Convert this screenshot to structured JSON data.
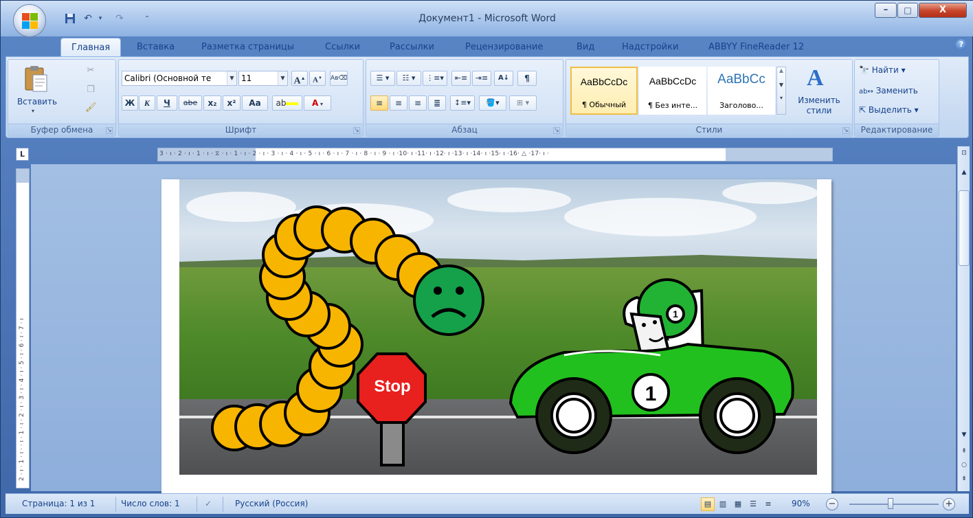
{
  "window": {
    "title": "Документ1 - Microsoft Word",
    "buttons": {
      "minimize": "–",
      "maximize": "□",
      "close": "X"
    }
  },
  "quick_access": {
    "save_icon": "save-icon",
    "undo_icon": "undo-icon",
    "redo_icon": "redo-icon"
  },
  "tabs": [
    {
      "label": "Главная",
      "active": true
    },
    {
      "label": "Вставка"
    },
    {
      "label": "Разметка страницы"
    },
    {
      "label": "Ссылки"
    },
    {
      "label": "Рассылки"
    },
    {
      "label": "Рецензирование"
    },
    {
      "label": "Вид"
    },
    {
      "label": "Надстройки"
    },
    {
      "label": "ABBYY FineReader 12"
    }
  ],
  "ribbon": {
    "clipboard": {
      "label": "Буфер обмена",
      "paste": "Вставить"
    },
    "font": {
      "label": "Шрифт",
      "font_name": "Calibri (Основной те",
      "font_size": "11",
      "bold": "Ж",
      "italic": "К",
      "underline": "Ч",
      "strike": "abe",
      "subscript": "x₂",
      "superscript": "x²",
      "case": "Aa"
    },
    "paragraph": {
      "label": "Абзац",
      "pilcrow": "¶"
    },
    "styles": {
      "label": "Стили",
      "items": [
        {
          "sample": "AaBbCcDc",
          "name": "¶ Обычный"
        },
        {
          "sample": "AaBbCcDc",
          "name": "¶ Без инте..."
        },
        {
          "sample": "AaBbCc",
          "name": "Заголово..."
        }
      ],
      "change_styles": "Изменить стили"
    },
    "editing": {
      "label": "Редактирование",
      "find": "Найти",
      "replace": "Заменить",
      "select": "Выделить"
    }
  },
  "ruler": {
    "horizontal": "3 · ı · 2 · ı · 1 · ı · ⧖ · ı · 1 · ı · 2 · ı · 3 · ı · 4 · ı · 5 · ı · 6 · ı · 7 · ı · 8 · ı · 9 · ı ·10· ı ·11· ı ·12· ı ·13· ı ·14· ı ·15· ı ·16· △ ·17· ı ·",
    "vertical": "2 · ı · 1 · ı · · ı · 1 · ı · 2 · ı · 3 · ı · 4 · ı · 5 · ı · 6 · ı · 7 · ı"
  },
  "picture": {
    "stop_sign_text": "Stop",
    "car_number": "1",
    "helmet_number": "1",
    "colors": {
      "worm": "#f7b500",
      "worm_head": "#14a14a",
      "stop": "#e8201e",
      "car": "#22c01e",
      "helmet": "#22b334"
    }
  },
  "status": {
    "page": "Страница: 1 из 1",
    "words": "Число слов: 1",
    "language": "Русский (Россия)",
    "zoom": "90%"
  }
}
